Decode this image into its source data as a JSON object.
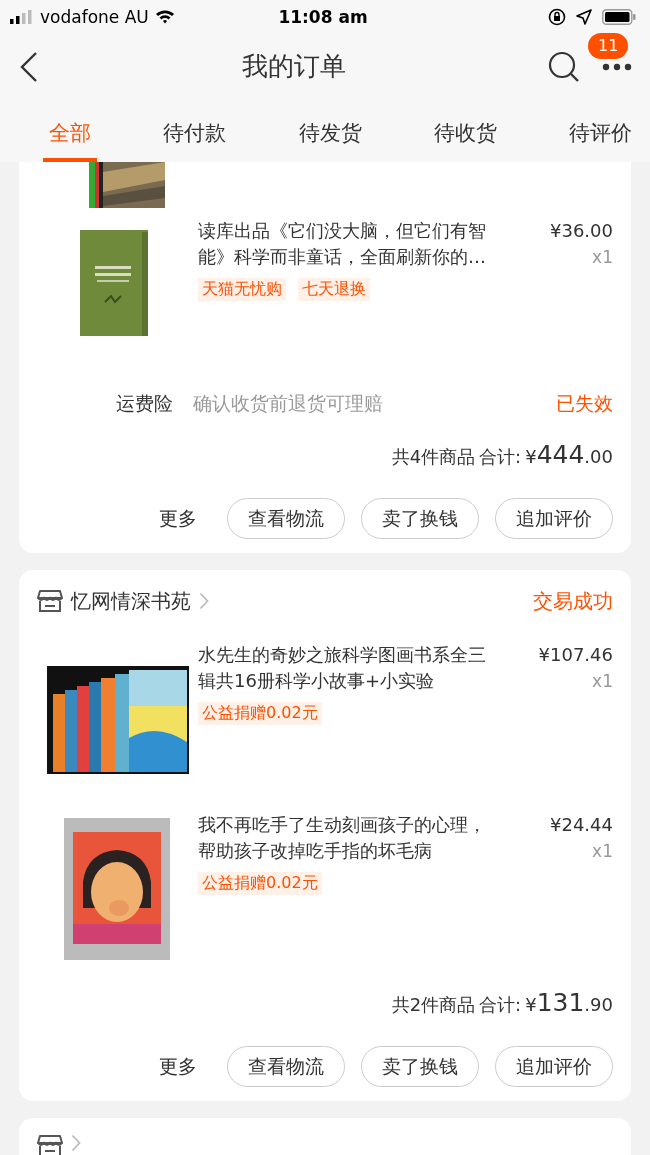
{
  "status_bar": {
    "carrier": "vodafone AU",
    "time": "11:08 am"
  },
  "nav": {
    "title": "我的订单",
    "badge": "11"
  },
  "tabs": [
    {
      "label": "全部",
      "selected": true
    },
    {
      "label": "待付款",
      "selected": false
    },
    {
      "label": "待发货",
      "selected": false
    },
    {
      "label": "待收货",
      "selected": false
    },
    {
      "label": "待评价",
      "selected": false
    }
  ],
  "orders": [
    {
      "items": [
        {
          "kind": "picture"
        },
        {
          "kind": "product",
          "title": "读库出品《它们没大脑，但它们有智能》科学而非童话，全面刷新你的…",
          "price": "¥36.00",
          "quantity": "x1",
          "tags": [
            "天猫无忧购",
            "七天退换"
          ]
        }
      ],
      "insurance": {
        "label": "运费险",
        "text": "确认收货前退货可理赔",
        "status": "已失效"
      },
      "total": {
        "count": "共4件商品",
        "label": "合计:",
        "currency": "¥",
        "integer": "444",
        "decimal": ".00"
      },
      "more": "更多",
      "buttons": [
        "查看物流",
        "卖了换钱",
        "追加评价"
      ]
    },
    {
      "store": {
        "name": "忆网情深书苑",
        "status": "交易成功"
      },
      "items": [
        {
          "kind": "product",
          "title": "水先生的奇妙之旅科学图画书系全三辑共16册科学小故事+小实验",
          "price": "¥107.46",
          "quantity": "x1",
          "tags": [
            "公益捐赠0.02元"
          ]
        },
        {
          "kind": "product",
          "title": "我不再吃手了生动刻画孩子的心理，帮助孩子改掉吃手指的坏毛病",
          "price": "¥24.44",
          "quantity": "x1",
          "tags": [
            "公益捐赠0.02元"
          ]
        }
      ],
      "total": {
        "count": "共2件商品",
        "label": "合计:",
        "currency": "¥",
        "integer": "131",
        "decimal": ".90"
      },
      "more": "更多",
      "buttons": [
        "查看物流",
        "卖了换钱",
        "追加评价"
      ]
    },
    {
      "store": {
        "cut": true
      }
    }
  ]
}
